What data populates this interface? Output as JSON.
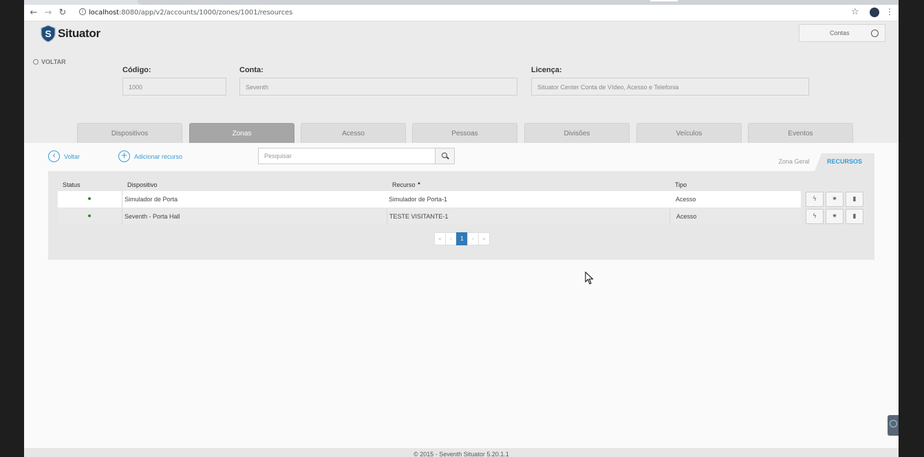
{
  "browser": {
    "url_host": "localhost",
    "url_rest": ":8080/app/v2/accounts/1000/zones/1001/resources"
  },
  "app": {
    "brand": "Situator",
    "logo_letter": "S",
    "accounts_button": "Contas",
    "back_top": "VOLTAR"
  },
  "account_info": {
    "code_label": "Código:",
    "code_value": "1000",
    "account_label": "Conta:",
    "account_value": "Seventh",
    "license_label": "Licença:",
    "license_value": "Situator Center Conta de Vídeo, Acesso e Telefonia"
  },
  "tabs": [
    {
      "label": "Dispositivos"
    },
    {
      "label": "Zonas"
    },
    {
      "label": "Acesso"
    },
    {
      "label": "Pessoas"
    },
    {
      "label": "Divisões"
    },
    {
      "label": "Veículos"
    },
    {
      "label": "Eventos"
    }
  ],
  "actions": {
    "back_label": "Voltar",
    "add_label": "Adicionar recurso",
    "search_placeholder": "Pesquisar"
  },
  "zone_tabs": {
    "general": "Zona Geral",
    "resources": "RECURSOS"
  },
  "table": {
    "headers": {
      "status": "Status",
      "device": "Dispositivo",
      "resource": "Recurso",
      "sort_indicator": "▲",
      "type": "Tipo"
    },
    "rows": [
      {
        "device": "Simulador de Porta",
        "resource": "Simulador de Porta-1",
        "type": "Acesso"
      },
      {
        "device": "Seventh - Porta Hall",
        "resource": "TESTE VISITANTE-1",
        "type": "Acesso"
      }
    ]
  },
  "pagination": {
    "first": "«",
    "prev": "‹",
    "current": "1",
    "next": "›",
    "last": "»"
  },
  "footer": "© 2015 - Seventh Situator 5.20.1.1",
  "colors": {
    "accent": "#3a9bd5",
    "status_active": "#2e8b2e",
    "page_active": "#337ab7"
  }
}
